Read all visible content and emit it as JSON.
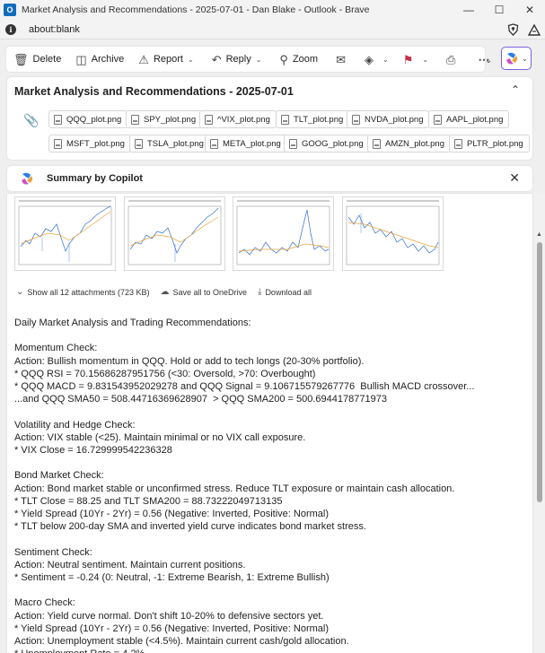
{
  "window": {
    "title": "Market Analysis and Recommendations - 2025-07-01 - Dan Blake - Outlook - Brave",
    "app_icon": "outlook-icon",
    "controls": [
      "minimize-icon",
      "maximize-icon",
      "close-icon"
    ]
  },
  "address_bar": {
    "url": "about:blank"
  },
  "toolbar": {
    "delete": "Delete",
    "archive": "Archive",
    "report": "Report",
    "reply": "Reply",
    "zoom": "Zoom",
    "accent": "#7b5fdb"
  },
  "subject": {
    "title": "Market Analysis and Recommendations - 2025-07-01",
    "attachments_row1": [
      "QQQ_plot.png",
      "SPY_plot.png",
      "^VIX_plot.png",
      "TLT_plot.png",
      "NVDA_plot.png",
      "AAPL_plot.png"
    ],
    "attachments_row2": [
      "MSFT_plot.png",
      "TSLA_plot.png",
      "META_plot.png",
      "GOOG_plot.png",
      "AMZN_plot.png",
      "PLTR_plot.png"
    ]
  },
  "copilot": {
    "label": "Summary by Copilot"
  },
  "attachment_actions": {
    "show_all": "Show all 12 attachments (723 KB)",
    "save_onedrive": "Save all to OneDrive",
    "download": "Download all"
  },
  "body": {
    "lines": [
      "Daily Market Analysis and Trading Recommendations:",
      "",
      "Momentum Check:",
      "Action: Bullish momentum in QQQ. Hold or add to tech longs (20-30% portfolio).",
      "* QQQ RSI = 70.15686287951756 (<30: Oversold, >70: Overbought)",
      "* QQQ MACD = 9.831543952029278 and QQQ Signal = 9.106715579267776  Bullish MACD crossover...",
      "...and QQQ SMA50 = 508.44716369628907  > QQQ SMA200 = 500.6944178771973",
      "",
      "Volatility and Hedge Check:",
      "Action: VIX stable (<25). Maintain minimal or no VIX call exposure.",
      "* VIX Close = 16.729999542236328",
      "",
      "Bond Market Check:",
      "Action: Bond market stable or unconfirmed stress. Reduce TLT exposure or maintain cash allocation.",
      "* TLT Close = 88.25 and TLT SMA200 = 88.73222049713135",
      "* Yield Spread (10Yr - 2Yr) = 0.56 (Negative: Inverted, Positive: Normal)",
      "* TLT below 200-day SMA and inverted yield curve indicates bond market stress.",
      "",
      "Sentiment Check:",
      "Action: Neutral sentiment. Maintain current positions.",
      "* Sentiment = -0.24 (0: Neutral, -1: Extreme Bearish, 1: Extreme Bullish)",
      "",
      "Macro Check:",
      "Action: Yield curve normal. Don't shift 10-20% to defensive sectors yet.",
      "* Yield Spread (10Yr - 2Yr) = 0.56 (Negative: Inverted, Positive: Normal)",
      "Action: Unemployment stable (<4.5%). Maintain current cash/gold allocation.",
      "* Unemployment Rate = 4.2%"
    ]
  }
}
